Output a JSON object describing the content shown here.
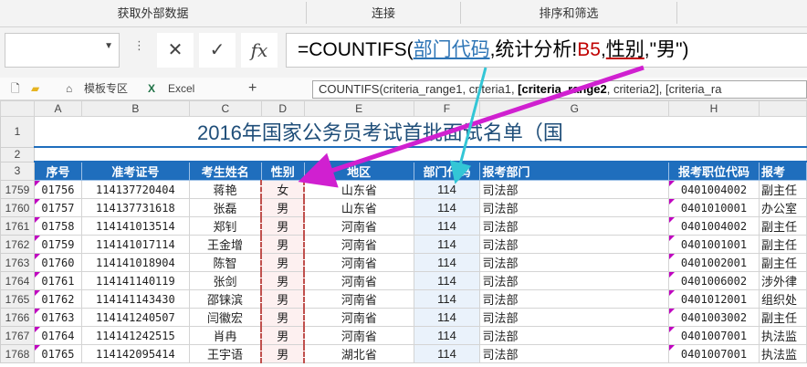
{
  "ribbon": {
    "groups": [
      "获取外部数据",
      "连接",
      "排序和筛选"
    ]
  },
  "formula_bar": {
    "name_box": "",
    "cancel_icon": "close-icon",
    "enter_icon": "check-icon",
    "fx_label": "fx",
    "formula": {
      "prefix": "=COUNTIFS(",
      "arg1": "部门代码",
      "sep1": ",统计分析!",
      "arg2": "B5",
      "sep2": ",",
      "arg3": "性别",
      "suffix": ",\"男\")"
    }
  },
  "tabs": {
    "template_tab": "模板专区",
    "excel_tab": "Excel",
    "add": "+"
  },
  "tooltip": {
    "pre": "COUNTIFS(criteria_range1, criteria1, ",
    "bold": "[criteria_range2",
    "post": ", criteria2], [criteria_ra"
  },
  "sheet": {
    "col_headers": [
      "A",
      "B",
      "C",
      "D",
      "E",
      "F",
      "G",
      "H",
      ""
    ],
    "row1_title": "2016年国家公务员考试首批面试名单（国",
    "header_row": [
      "序号",
      "准考证号",
      "考生姓名",
      "性别",
      "地区",
      "部门代码",
      "报考部门",
      "报考职位代码",
      "报考"
    ],
    "rows": [
      {
        "rn": "1759",
        "cells": [
          "01756",
          "114137720404",
          "蒋艳",
          "女",
          "山东省",
          "114",
          "司法部",
          "0401004002",
          "副主任"
        ]
      },
      {
        "rn": "1760",
        "cells": [
          "01757",
          "114137731618",
          "张磊",
          "男",
          "山东省",
          "114",
          "司法部",
          "0401010001",
          "办公室"
        ]
      },
      {
        "rn": "1761",
        "cells": [
          "01758",
          "114141013514",
          "郑钊",
          "男",
          "河南省",
          "114",
          "司法部",
          "0401004002",
          "副主任"
        ]
      },
      {
        "rn": "1762",
        "cells": [
          "01759",
          "114141017114",
          "王金增",
          "男",
          "河南省",
          "114",
          "司法部",
          "0401001001",
          "副主任"
        ]
      },
      {
        "rn": "1763",
        "cells": [
          "01760",
          "114141018904",
          "陈智",
          "男",
          "河南省",
          "114",
          "司法部",
          "0401002001",
          "副主任"
        ]
      },
      {
        "rn": "1764",
        "cells": [
          "01761",
          "114141140119",
          "张剑",
          "男",
          "河南省",
          "114",
          "司法部",
          "0401006002",
          "涉外律"
        ]
      },
      {
        "rn": "1765",
        "cells": [
          "01762",
          "114141143430",
          "邵铼滨",
          "男",
          "河南省",
          "114",
          "司法部",
          "0401012001",
          "组织处"
        ]
      },
      {
        "rn": "1766",
        "cells": [
          "01763",
          "114141240507",
          "闫徽宏",
          "男",
          "河南省",
          "114",
          "司法部",
          "0401003002",
          "副主任"
        ]
      },
      {
        "rn": "1767",
        "cells": [
          "01764",
          "114141242515",
          "肖冉",
          "男",
          "河南省",
          "114",
          "司法部",
          "0401007001",
          "执法监"
        ]
      },
      {
        "rn": "1768",
        "cells": [
          "01765",
          "114142095414",
          "王宇语",
          "男",
          "湖北省",
          "114",
          "司法部",
          "0401007001",
          "执法监"
        ]
      }
    ]
  },
  "colors": {
    "header_blue": "#1f6ebd",
    "ref_blue": "#2e75b6",
    "ref_red": "#c00000",
    "arrow_magenta": "#d020d0",
    "arrow_cyan": "#33c6d6"
  }
}
